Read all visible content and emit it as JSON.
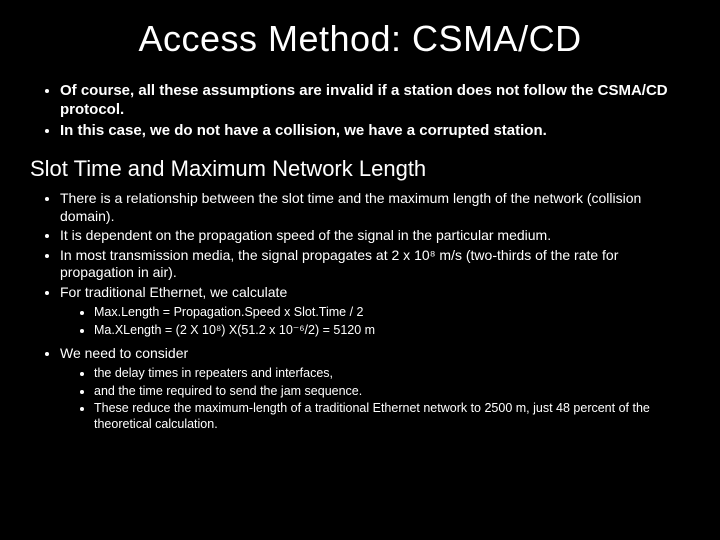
{
  "title": "Access Method: CSMA/CD",
  "intro": [
    "Of course, all these assumptions are invalid if a station does not follow the CSMA/CD protocol.",
    "In this case, we do not have a collision, we have a corrupted station."
  ],
  "subhead": "Slot Time and Maximum Network Length",
  "points": [
    "There is a relationship between the slot time and the maximum length of the network (collision domain).",
    "It is dependent on the propagation speed of the signal in the particular medium.",
    "In most transmission media, the signal propagates at 2 x 10⁸ m/s (two-thirds of the rate for propagation in air).",
    "For traditional Ethernet, we calculate"
  ],
  "calc": [
    "Max.Length = Propagation.Speed x Slot.Time / 2",
    "Ma.XLength = (2 X 10⁸) X(51.2 x 10⁻⁶/2) = 5120  m"
  ],
  "consider_lead": "We need to consider",
  "consider": [
    "the delay times in repeaters and interfaces,",
    "and the time required to send the jam sequence.",
    "These reduce the maximum-length of a traditional Ethernet network to 2500 m, just 48 percent of the theoretical calculation."
  ]
}
